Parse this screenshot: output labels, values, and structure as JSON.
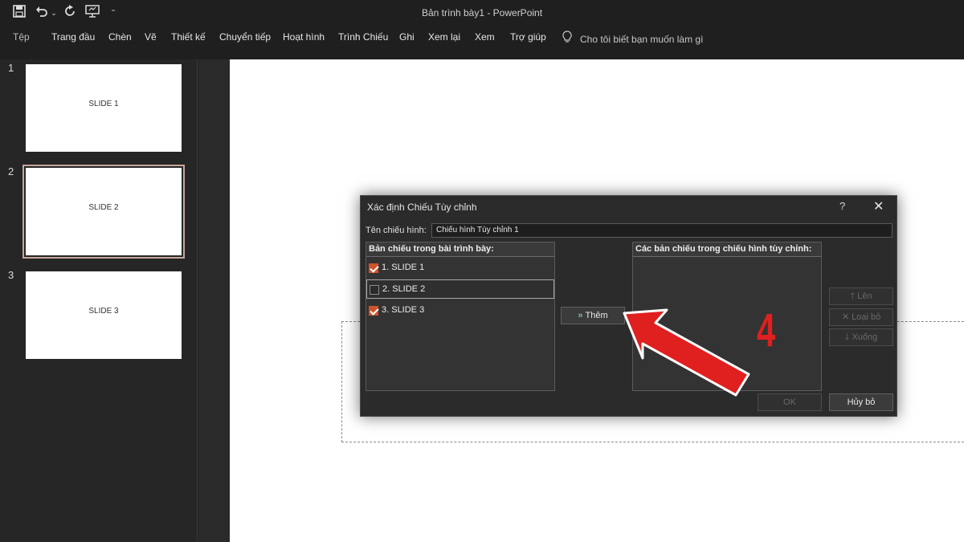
{
  "titlebar": {
    "title": "Bản trình bày1  -  PowerPoint",
    "quick_access": [
      "save-icon",
      "undo-icon",
      "dropdown-icon",
      "redo-icon",
      "present-icon",
      "customize-icon"
    ]
  },
  "ribbon": {
    "tabs": [
      "Tệp",
      "Trang đầu",
      "Chèn",
      "Vẽ",
      "Thiết kế",
      "Chuyển tiếp",
      "Hoạt hình",
      "Trình Chiếu",
      "Ghi",
      "Xem lại",
      "Xem",
      "Trợ giúp"
    ],
    "tell_me": "Cho tôi biết bạn muốn làm gì"
  },
  "thumbnails": [
    {
      "number": "1",
      "text": "SLIDE 1",
      "selected": false
    },
    {
      "number": "2",
      "text": "SLIDE 2",
      "selected": true
    },
    {
      "number": "3",
      "text": "SLIDE 3",
      "selected": false
    }
  ],
  "dialog": {
    "title": "Xác định Chiếu Tùy chỉnh",
    "help": "?",
    "close": "✕",
    "name_label": "Tên chiếu hình:",
    "name_value": "Chiếu hình Tùy chỉnh 1",
    "left_header": "Bản chiếu trong bài trình bày:",
    "right_header": "Các bản chiếu trong chiếu hình tùy chỉnh:",
    "slides": [
      {
        "label": "1. SLIDE 1",
        "checked": true
      },
      {
        "label": "2. SLIDE 2",
        "checked": false
      },
      {
        "label": "3. SLIDE 3",
        "checked": true
      }
    ],
    "add_label": "Thêm",
    "up_label": "Lên",
    "remove_label": "Loại bỏ",
    "down_label": "Xuống",
    "ok_label": "OK",
    "cancel_label": "Hủy bỏ"
  },
  "annotation": {
    "step": "4",
    "color": "#e01f1f"
  }
}
